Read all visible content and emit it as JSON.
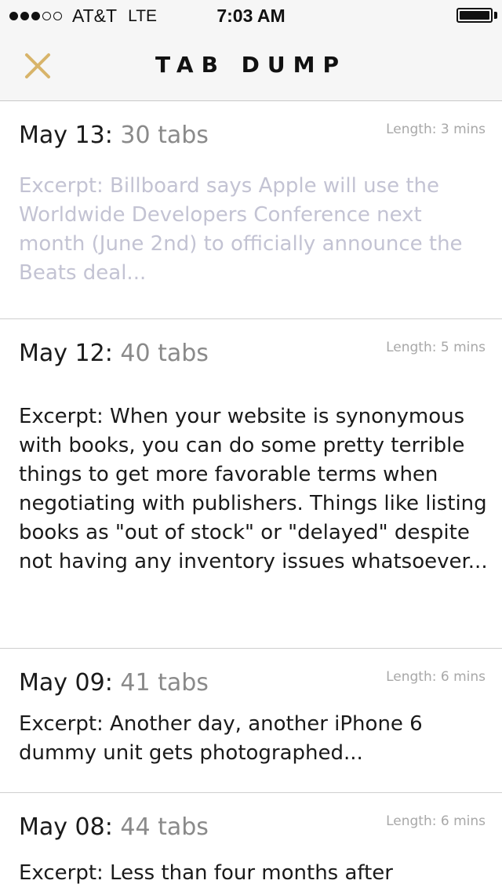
{
  "status_bar": {
    "carrier": "AT&T",
    "network": "LTE",
    "time": "7:03 AM",
    "signal_bars_filled": 3,
    "signal_bars_total": 5
  },
  "nav": {
    "title": "TAB DUMP",
    "close_icon": "close-x-icon",
    "accent_color": "#d8b46a"
  },
  "items": [
    {
      "date": "May 13",
      "separator": ":",
      "count": " 30 tabs",
      "length": "Length: 3 mins",
      "excerpt": "Excerpt: Billboard says Apple will use the Worldwide Developers Conference next month (June 2nd) to officially announce the Beats deal..."
    },
    {
      "date": "May 12",
      "separator": ":",
      "count": " 40 tabs",
      "length": "Length: 5 mins",
      "excerpt": "Excerpt: When your website is synonymous with books, you can do some pretty terrible things to get more favorable terms when negotiating with publishers. Things like listing books as \"out of stock\" or \"delayed\" despite not having any inventory issues whatsoever..."
    },
    {
      "date": "May 09",
      "separator": ":",
      "count": " 41 tabs",
      "length": "Length: 6 mins",
      "excerpt": "Excerpt: Another day, another iPhone 6 dummy unit gets photographed..."
    },
    {
      "date": "May 08",
      "separator": ":",
      "count": " 44 tabs",
      "length": "Length: 6 mins",
      "excerpt": "Excerpt: Less than four months after"
    }
  ]
}
